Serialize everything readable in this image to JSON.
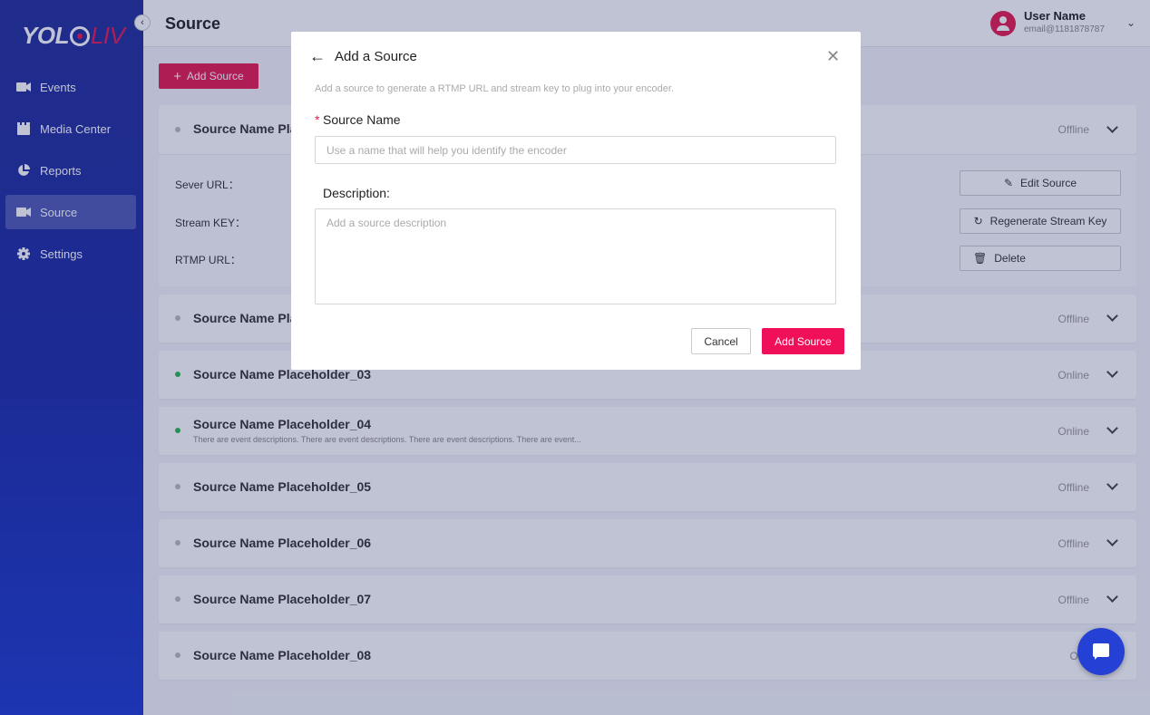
{
  "app": {
    "logo_text_a": "YOL",
    "logo_text_b": "LIV"
  },
  "sidebar": {
    "items": [
      {
        "label": "Events",
        "icon": "camera-icon"
      },
      {
        "label": "Media Center",
        "icon": "clapperboard-icon"
      },
      {
        "label": "Reports",
        "icon": "pie-chart-icon"
      },
      {
        "label": "Source",
        "icon": "video-icon",
        "active": true
      },
      {
        "label": "Settings",
        "icon": "gear-icon"
      }
    ]
  },
  "header": {
    "title": "Source",
    "user_name": "User Name",
    "user_email": "email@1181878787"
  },
  "main": {
    "add_source_label": "Add Source",
    "sources": [
      {
        "name": "Source Name Pla",
        "status": "Offline"
      },
      {
        "name": "Source Name Pla",
        "status": "Offline"
      },
      {
        "name": "Source Name Placeholder_03",
        "status": "Online"
      },
      {
        "name": "Source Name Placeholder_04",
        "status": "Online",
        "description": "There are event descriptions. There are event descriptions. There are event descriptions. There are event..."
      },
      {
        "name": "Source Name Placeholder_05",
        "status": "Offline"
      },
      {
        "name": "Source Name Placeholder_06",
        "status": "Offline"
      },
      {
        "name": "Source Name Placeholder_07",
        "status": "Offline"
      },
      {
        "name": "Source Name Placeholder_08",
        "status": "Offl"
      }
    ],
    "detail": {
      "server_url_label": "Sever URL：",
      "stream_key_label": "Stream KEY：",
      "rtmp_url_label": "RTMP URL：",
      "edit_label": "Edit Source",
      "regen_label": "Regenerate Stream Key",
      "delete_label": "Delete"
    }
  },
  "modal": {
    "title": "Add a Source",
    "subtitle": "Add a source to generate a RTMP URL and stream key to plug into your encoder.",
    "required_mark": "*",
    "name_label": "Source Name",
    "name_placeholder": "Use a name that will help you identify the encoder",
    "name_value": "",
    "desc_label": "Description:",
    "desc_placeholder": "Add a source description",
    "desc_value": "",
    "cancel_label": "Cancel",
    "submit_label": "Add Source"
  },
  "colors": {
    "accent": "#e8194f",
    "sidebar": "#22309a",
    "online": "#2db84d",
    "chat": "#2540d4"
  }
}
